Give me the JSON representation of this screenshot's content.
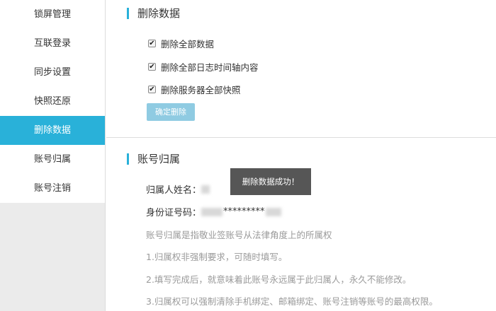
{
  "sidebar": {
    "items": [
      {
        "label": "锁屏管理"
      },
      {
        "label": "互联登录"
      },
      {
        "label": "同步设置"
      },
      {
        "label": "快照还原"
      },
      {
        "label": "删除数据"
      },
      {
        "label": "账号归属"
      },
      {
        "label": "账号注销"
      }
    ],
    "active_index": 4
  },
  "delete_section": {
    "title": "删除数据",
    "options": [
      {
        "label": "删除全部数据",
        "checked": true
      },
      {
        "label": "删除全部日志时间轴内容",
        "checked": true
      },
      {
        "label": "删除服务器全部快照",
        "checked": true
      }
    ],
    "confirm_label": "确定删除"
  },
  "ownership_section": {
    "title": "账号归属",
    "name_label": "归属人姓名：",
    "id_label": "身份证号码：",
    "id_masked": "*********",
    "notes": [
      "账号归属是指敬业签账号从法律角度上的所属权",
      "1.归属权非强制要求，可随时填写。",
      "2.填写完成后，就意味着此账号永远属于此归属人，永久不能修改。",
      "3.归属权可以强制清除手机绑定、邮箱绑定、账号注销等账号的最高权限。"
    ]
  },
  "toast": {
    "text": "删除数据成功！"
  },
  "colors": {
    "accent": "#29b1d9",
    "button_disabled": "#8fcbe2",
    "toast_bg": "#4d4d4d"
  }
}
